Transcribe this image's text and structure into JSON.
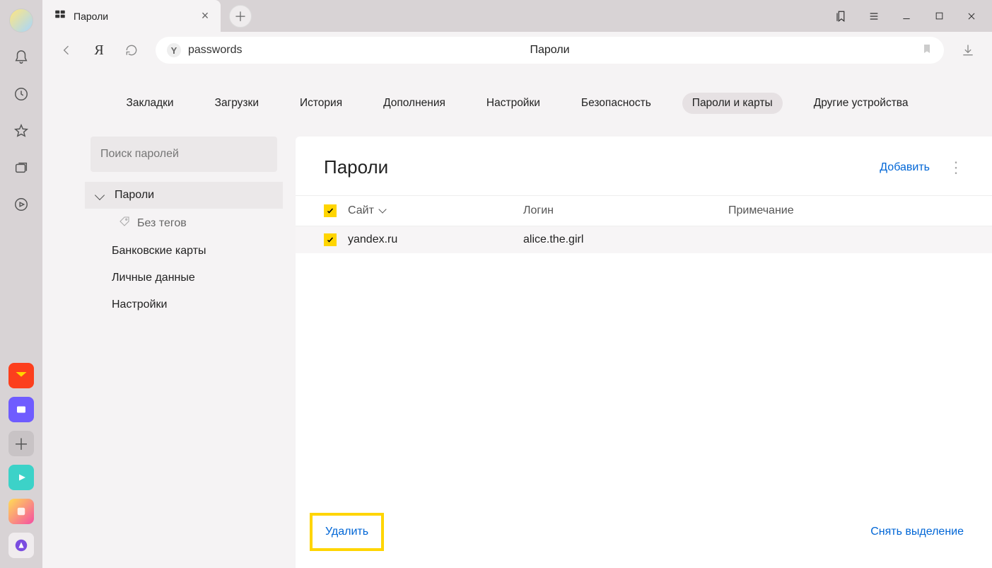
{
  "tab": {
    "title": "Пароли"
  },
  "omnibox": {
    "text": "passwords",
    "center_label": "Пароли"
  },
  "topmenu": {
    "items": [
      "Закладки",
      "Загрузки",
      "История",
      "Дополнения",
      "Настройки",
      "Безопасность",
      "Пароли и карты",
      "Другие устройства"
    ],
    "active_index": 6
  },
  "sidebar": {
    "search_placeholder": "Поиск паролей",
    "passwords_header": "Пароли",
    "no_tags": "Без тегов",
    "bank_cards": "Банковские карты",
    "personal_data": "Личные данные",
    "settings": "Настройки"
  },
  "main": {
    "title": "Пароли",
    "add_label": "Добавить",
    "columns": {
      "site": "Сайт",
      "login": "Логин",
      "note": "Примечание"
    },
    "rows": [
      {
        "site": "yandex.ru",
        "login": "alice.the.girl",
        "note": ""
      }
    ],
    "delete_label": "Удалить",
    "deselect_label": "Снять выделение"
  }
}
